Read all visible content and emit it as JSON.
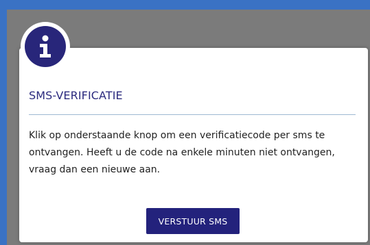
{
  "dialog": {
    "title": "SMS-VERIFICATIE",
    "message": "Klik op onderstaande knop om een verificatiecode per sms te ontvangen. Heeft u de code na enkele minuten niet ontvangen, vraag dan een nieuwe aan.",
    "button_label": "VERSTUUR SMS",
    "icon": "info-icon"
  },
  "colors": {
    "accent": "#28267a",
    "button": "#23227c",
    "outer_frame": "#3a72c4",
    "backdrop": "#7b7b7b"
  }
}
